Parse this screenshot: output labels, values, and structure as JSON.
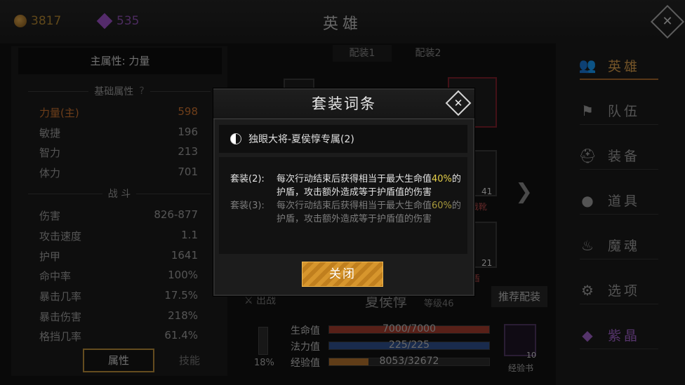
{
  "topbar": {
    "gold": "3817",
    "gems": "535",
    "title": "英雄",
    "close_icon": "close-icon"
  },
  "left_panel": {
    "main_attr": "主属性: 力量",
    "basic_header": "基础属性",
    "help_mark": "?",
    "basic": [
      {
        "label": "力量(主)",
        "value": "598"
      },
      {
        "label": "敏捷",
        "value": "196"
      },
      {
        "label": "智力",
        "value": "213"
      },
      {
        "label": "体力",
        "value": "701"
      }
    ],
    "combat_header": "战 斗",
    "combat": [
      {
        "label": "伤害",
        "value": "826-877"
      },
      {
        "label": "攻击速度",
        "value": "1.1"
      },
      {
        "label": "护甲",
        "value": "1641"
      },
      {
        "label": "命中率",
        "value": "100%"
      },
      {
        "label": "暴击几率",
        "value": "17.5%"
      },
      {
        "label": "暴击伤害",
        "value": "218%"
      },
      {
        "label": "格挡几率",
        "value": "61.4%"
      }
    ],
    "tabs": [
      "属性",
      "技能"
    ]
  },
  "center": {
    "loadout_tabs": [
      "配装1",
      "配装2"
    ],
    "slot_counts": [
      "41",
      "21"
    ],
    "slot_labels": [
      "战靴",
      "盾"
    ],
    "battle": "出战",
    "hero_name": "夏侯惇",
    "level": "等级46",
    "recommend": "推荐配装",
    "stats": [
      {
        "label": "生命值",
        "text": "7000/7000",
        "fraction": 1.0,
        "color": "#a13b2c"
      },
      {
        "label": "法力值",
        "text": "225/225",
        "fraction": 1.0,
        "color": "#2f4f8c"
      },
      {
        "label": "经验值",
        "text": "8053/32672",
        "fraction": 0.246,
        "color": "#b0702c"
      }
    ],
    "sword_pct": "18%",
    "xp_book_count": "10",
    "xp_book_label": "经验书"
  },
  "nav": {
    "items": [
      {
        "label": "英雄",
        "icon": "heroes-icon"
      },
      {
        "label": "队伍",
        "icon": "flag-icon"
      },
      {
        "label": "装备",
        "icon": "helmet-icon"
      },
      {
        "label": "道具",
        "icon": "bag-icon"
      },
      {
        "label": "魔魂",
        "icon": "flame-icon"
      },
      {
        "label": "选项",
        "icon": "gear-icon"
      },
      {
        "label": "紫晶",
        "icon": "crystal-icon"
      }
    ],
    "active_index": 0
  },
  "modal": {
    "title": "套装词条",
    "set_name": "独眼大将-夏侯惇专属(2)",
    "bonuses": [
      {
        "key": "套装(2):",
        "pre": "每次行动结束后获得相当于最大生命值",
        "pct": "40%",
        "post": "的护盾，攻击额外造成等于护盾值的伤害",
        "active": true
      },
      {
        "key": "套装(3):",
        "pre": "每次行动结束后获得相当于最大生命值",
        "pct": "60%",
        "post": "的护盾，攻击额外造成等于护盾值的伤害",
        "active": false
      }
    ],
    "close_button": "关闭"
  }
}
